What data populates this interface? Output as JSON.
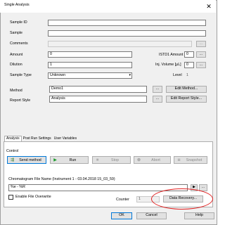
{
  "window": {
    "title": "Single Analysis",
    "close_label": "✕"
  },
  "fields": {
    "sample_id_label": "Sample ID",
    "sample_label": "Sample",
    "comments_label": "Comments",
    "comments_button": "...",
    "amount_label": "Amount",
    "amount_value": "0",
    "istd1_label": "ISTD1 Amount",
    "istd1_value": "0",
    "istd1_button": "...",
    "dilution_label": "Dilution",
    "dilution_value": "1",
    "inj_volume_label": "Inj. Volume [µL]",
    "inj_volume_value": "0",
    "inj_volume_button": "...",
    "sample_type_label": "Sample Type",
    "sample_type_value": "Unknown",
    "level_label": "Level",
    "level_value": "1",
    "method_label": "Method",
    "method_value": "Demo1",
    "method_button": "...",
    "edit_method_button": "Edit Method...",
    "report_style_label": "Report Style",
    "report_style_value": "Analysis",
    "report_style_button": "...",
    "edit_report_button": "Edit Report Style..."
  },
  "tabs": [
    "Analysis",
    "Post Run Settings",
    "User Variables"
  ],
  "control": {
    "label": "Control",
    "send_method": "Send method",
    "run": "Run",
    "stop": "Stop",
    "abort": "Abort",
    "snapshot": "Snapshot"
  },
  "chromatogram": {
    "label": "Chromatogram File Name (Instrument 1 - 03.04.2018 15_03_59)",
    "value": "%e - %R",
    "arrow_button": "▶",
    "dots_button": "...",
    "enable_overwrite": "Enable File Overwrite",
    "counter_label": "Counter",
    "counter_value": "1",
    "data_recovery": "Data Recovery..."
  },
  "footer": {
    "ok": "OK",
    "cancel": "Cancel",
    "help": "Help"
  },
  "colors": {
    "highlight_oval": "#e02020",
    "run_icon": "#1a9a2a",
    "send_icon": "#2a7a2a"
  }
}
